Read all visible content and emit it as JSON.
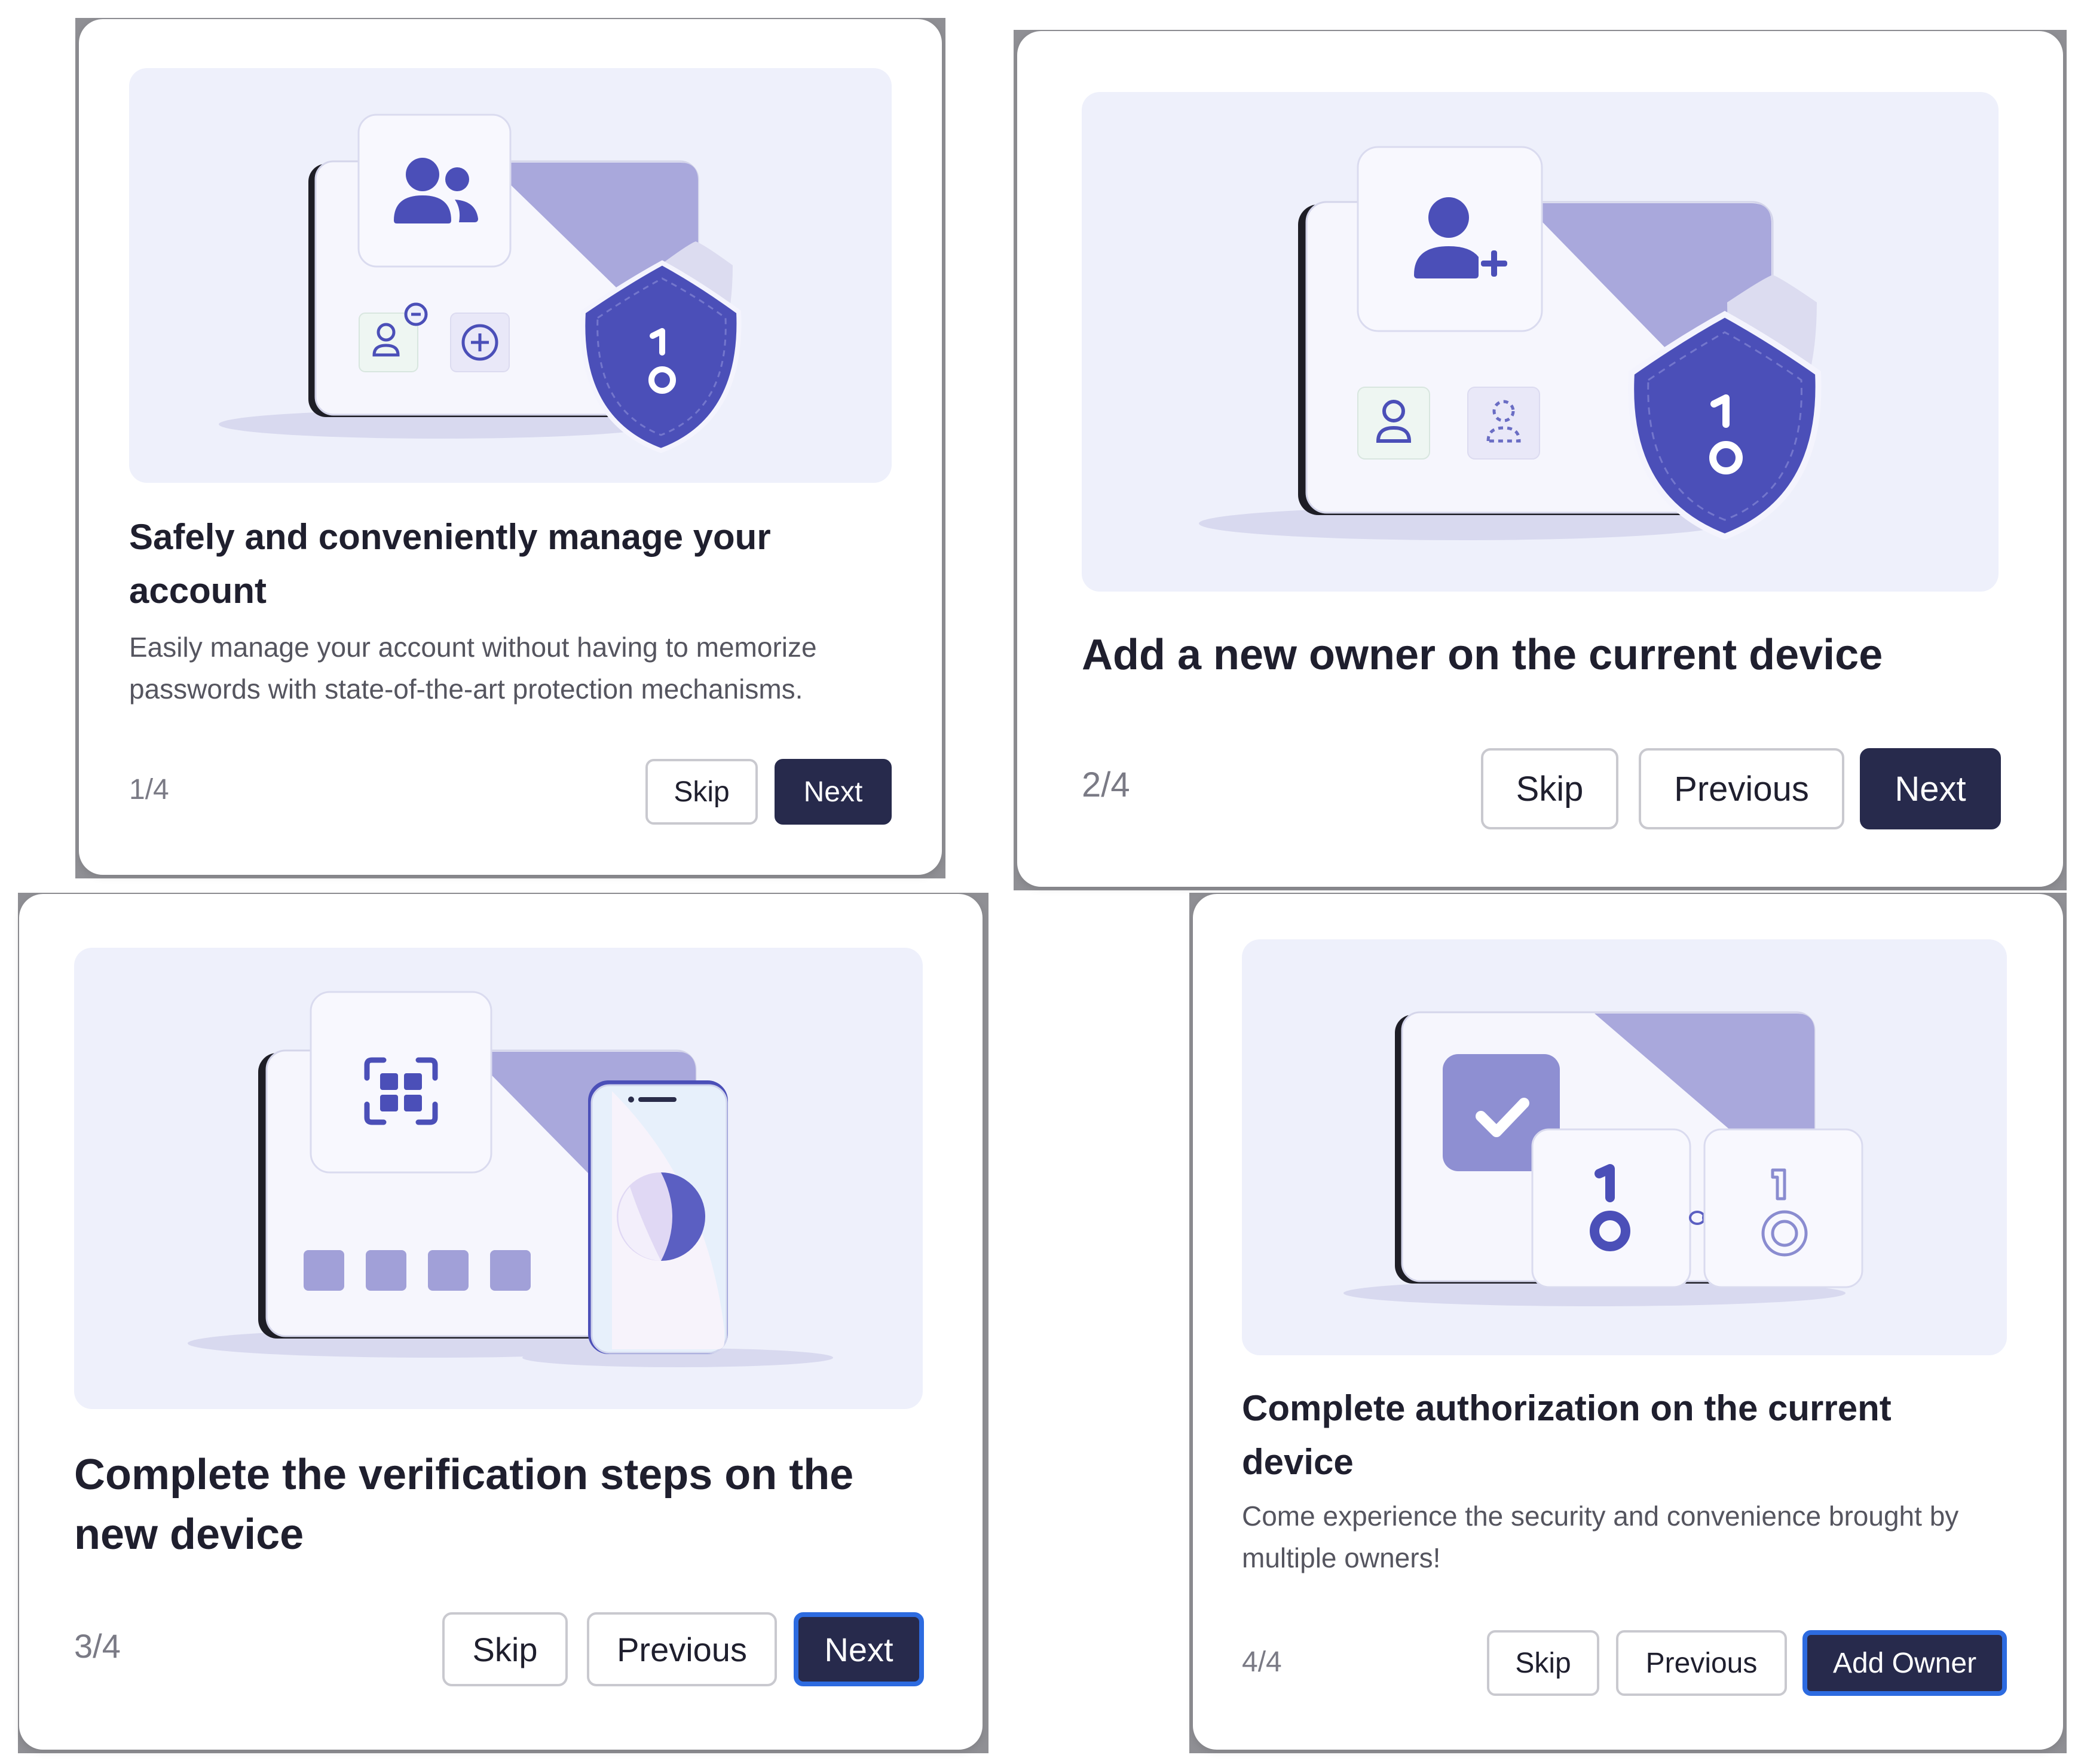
{
  "colors": {
    "primary_button": "#272a4c",
    "focus_ring": "#2d6be0",
    "illustration_bg": "#eef0fb",
    "accent": "#4b4fb8"
  },
  "cards": [
    {
      "step": "1/4",
      "title": "Safely and conveniently manage your account",
      "description": "Easily manage your account without having to memorize passwords with state-of-the-art protection mechanisms.",
      "buttons": {
        "skip": "Skip",
        "next": "Next"
      },
      "icons": [
        "users-icon",
        "remove-user-icon",
        "add-circle-icon",
        "shield-key-icon"
      ]
    },
    {
      "step": "2/4",
      "title": "Add a new owner on the current device",
      "buttons": {
        "skip": "Skip",
        "previous": "Previous",
        "next": "Next"
      },
      "icons": [
        "add-user-icon",
        "user-icon",
        "user-dashed-icon",
        "shield-key-icon"
      ]
    },
    {
      "step": "3/4",
      "title": "Complete the verification steps on the new device",
      "buttons": {
        "skip": "Skip",
        "previous": "Previous",
        "next": "Next"
      },
      "icons": [
        "qr-scan-icon",
        "phone-icon",
        "code-boxes-icon"
      ]
    },
    {
      "step": "4/4",
      "title": "Complete authorization on the current device",
      "description": "Come experience the security and convenience brought by multiple owners!",
      "buttons": {
        "skip": "Skip",
        "previous": "Previous",
        "add_owner": "Add Owner"
      },
      "icons": [
        "check-icon",
        "key-icon",
        "link-icon",
        "key-outline-icon"
      ]
    }
  ]
}
